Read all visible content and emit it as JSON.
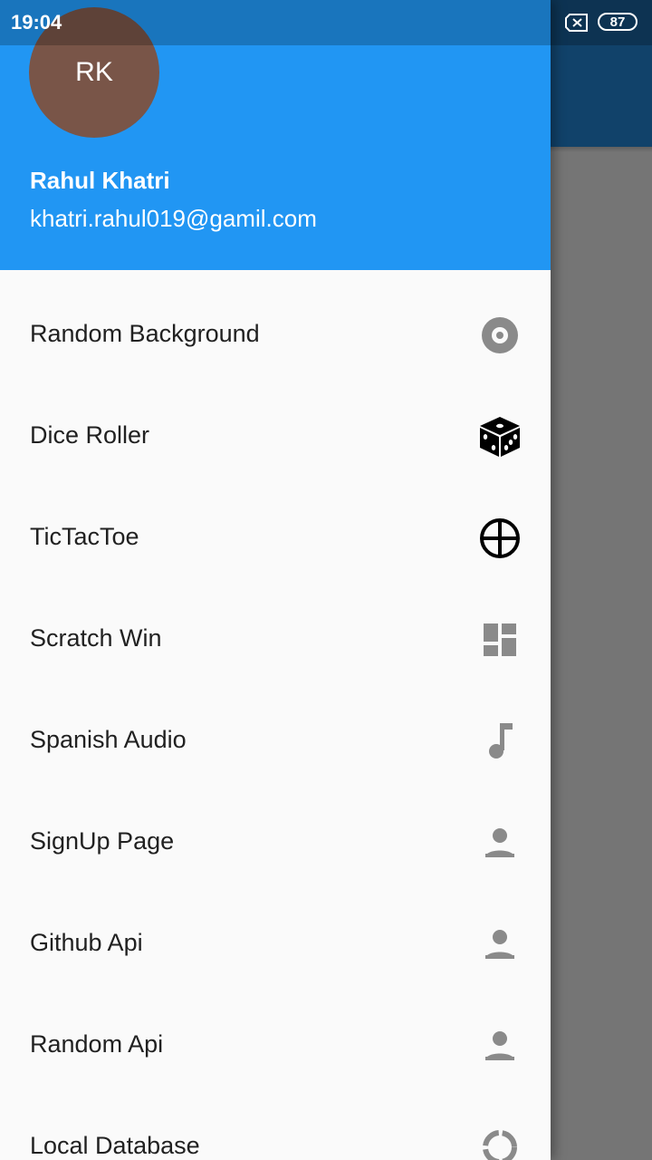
{
  "status_bar": {
    "time": "19:04",
    "battery_level": "87"
  },
  "drawer": {
    "header": {
      "avatar_initials": "RK",
      "account_name": "Rahul Khatri",
      "account_email": "khatri.rahul019@gamil.com"
    },
    "items": [
      {
        "label": "Random Background",
        "icon": "album-icon"
      },
      {
        "label": "Dice Roller",
        "icon": "dice-icon"
      },
      {
        "label": "TicTacToe",
        "icon": "crosshair-icon"
      },
      {
        "label": "Scratch Win",
        "icon": "dashboard-icon"
      },
      {
        "label": "Spanish Audio",
        "icon": "music-note-icon"
      },
      {
        "label": "SignUp Page",
        "icon": "person-icon"
      },
      {
        "label": "Github Api",
        "icon": "person-icon"
      },
      {
        "label": "Random Api",
        "icon": "person-icon"
      },
      {
        "label": "Local Database",
        "icon": "progress-ring-icon"
      }
    ]
  },
  "colors": {
    "header": "#2196f3",
    "avatar": "#795548",
    "drawer_bg": "#fafafa",
    "scrim": "#757575",
    "icon_grey": "#8a8a8a",
    "icon_black": "#000000",
    "text": "#212121"
  }
}
